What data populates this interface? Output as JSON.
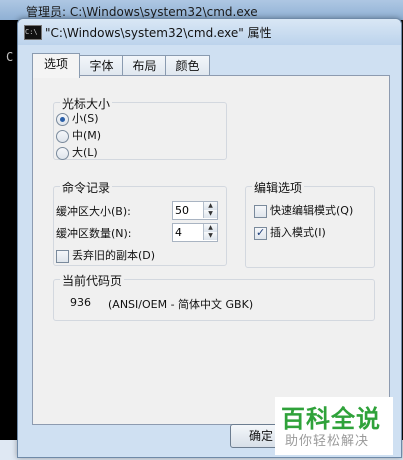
{
  "background_window": {
    "title": "管理员: C:\\Windows\\system32\\cmd.exe",
    "console_char": "C"
  },
  "dialog": {
    "icon_text": "C:\\",
    "title": "\"C:\\Windows\\system32\\cmd.exe\" 属性",
    "tabs": [
      {
        "label": "选项",
        "active": true
      },
      {
        "label": "字体",
        "active": false
      },
      {
        "label": "布局",
        "active": false
      },
      {
        "label": "颜色",
        "active": false
      }
    ],
    "cursor_size": {
      "legend": "光标大小",
      "options": [
        {
          "label": "小(S)",
          "checked": true
        },
        {
          "label": "中(M)",
          "checked": false
        },
        {
          "label": "大(L)",
          "checked": false
        }
      ]
    },
    "command_history": {
      "legend": "命令记录",
      "buffer_size_label": "缓冲区大小(B):",
      "buffer_size_value": "50",
      "buffer_count_label": "缓冲区数量(N):",
      "buffer_count_value": "4",
      "discard_old_label": "丢弃旧的副本(D)",
      "discard_old_checked": false
    },
    "edit_options": {
      "legend": "编辑选项",
      "quick_edit_label": "快速编辑模式(Q)",
      "quick_edit_checked": false,
      "insert_mode_label": "插入模式(I)",
      "insert_mode_checked": true
    },
    "code_page": {
      "legend": "当前代码页",
      "number": "936",
      "description": "(ANSI/OEM - 简体中文 GBK)"
    },
    "ok_label": "确定"
  },
  "watermark": {
    "main": "百科全说",
    "sub": "助你轻松解决"
  }
}
